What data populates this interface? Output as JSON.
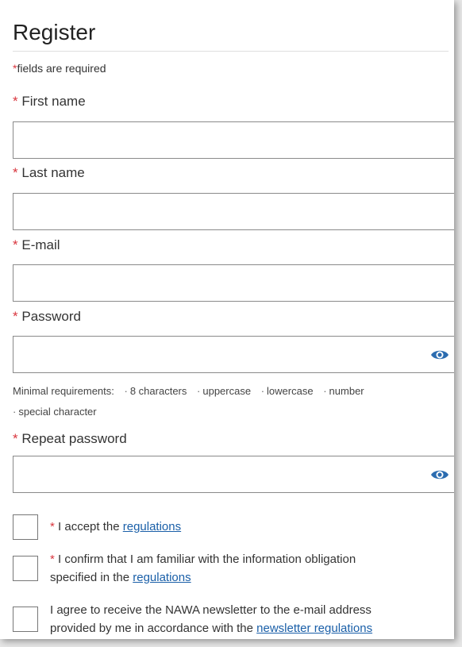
{
  "form": {
    "title": "Register",
    "required_note": "fields are required",
    "required_mark": "*",
    "fields": {
      "first_name": {
        "label": "First name",
        "value": ""
      },
      "last_name": {
        "label": "Last name",
        "value": ""
      },
      "email": {
        "label": "E-mail",
        "value": ""
      },
      "password": {
        "label": "Password",
        "value": ""
      },
      "repeat_password": {
        "label": "Repeat password",
        "value": ""
      }
    },
    "password_hint": {
      "prefix": "Minimal requirements:",
      "items": [
        "8 characters",
        "uppercase",
        "lowercase",
        "number",
        "special character"
      ],
      "bullet": "·"
    },
    "checkboxes": {
      "regulations": {
        "text": "I accept the ",
        "link": "regulations"
      },
      "info_obligation": {
        "text1": "I confirm that I am familiar with the information obligation",
        "text2": "specified in the ",
        "link": "regulations"
      },
      "newsletter": {
        "text1": "I agree to receive the NAWA newsletter to the e-mail address",
        "text2": "provided by me in accordance with the ",
        "link": "newsletter regulations"
      }
    },
    "icons": {
      "toggle_visibility": "eye-icon"
    },
    "colors": {
      "required": "#d9363e",
      "link": "#1a5fa8",
      "eye": "#2b6cb0"
    }
  }
}
